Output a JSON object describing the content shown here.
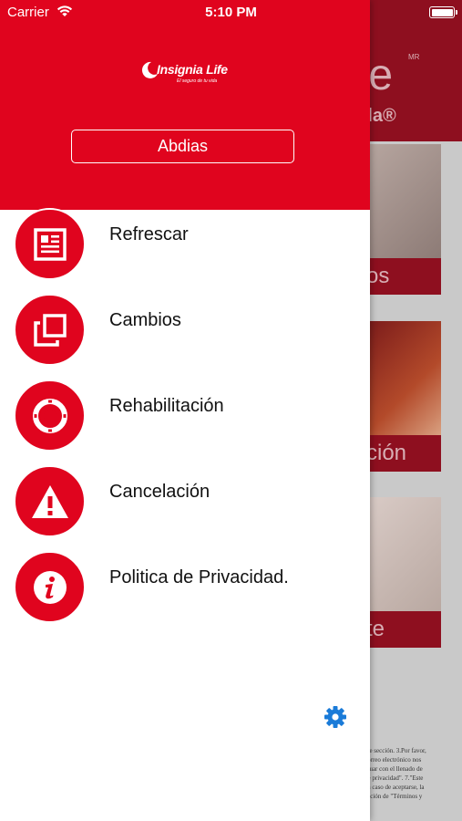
{
  "status_bar": {
    "carrier": "Carrier",
    "time": "5:10 PM"
  },
  "drawer": {
    "brand": {
      "name": "Insignia Life",
      "tagline": "El seguro de tu vida"
    },
    "user_name": "Abdias",
    "menu": [
      {
        "label": "Refrescar",
        "icon": "newspaper-icon"
      },
      {
        "label": "Cambios",
        "icon": "copy-squares-icon"
      },
      {
        "label": "Rehabilitación",
        "icon": "lifebuoy-icon"
      },
      {
        "label": "Cancelación",
        "icon": "warning-icon"
      },
      {
        "label": "Politica de Privacidad.",
        "icon": "info-icon"
      }
    ],
    "settings_icon": "gear-icon"
  },
  "background": {
    "logo_fragment": "fe",
    "logo_mark": "MR",
    "tagline_fragment": "vida®",
    "cards": [
      {
        "label": "os"
      },
      {
        "label": "ción"
      },
      {
        "label": "te"
      }
    ],
    "text_lines": [
      "nte sección. 3.Por favor,",
      "correo electrónico nos",
      "inuar con el llenado de",
      "de privacidad\". 7.\"Este",
      "en caso de aceptarse, la",
      "ección de \"Términos y"
    ]
  },
  "colors": {
    "brand_red": "#e0041e",
    "dark_red": "#8e0f1f",
    "settings_blue": "#1a7bd8"
  }
}
